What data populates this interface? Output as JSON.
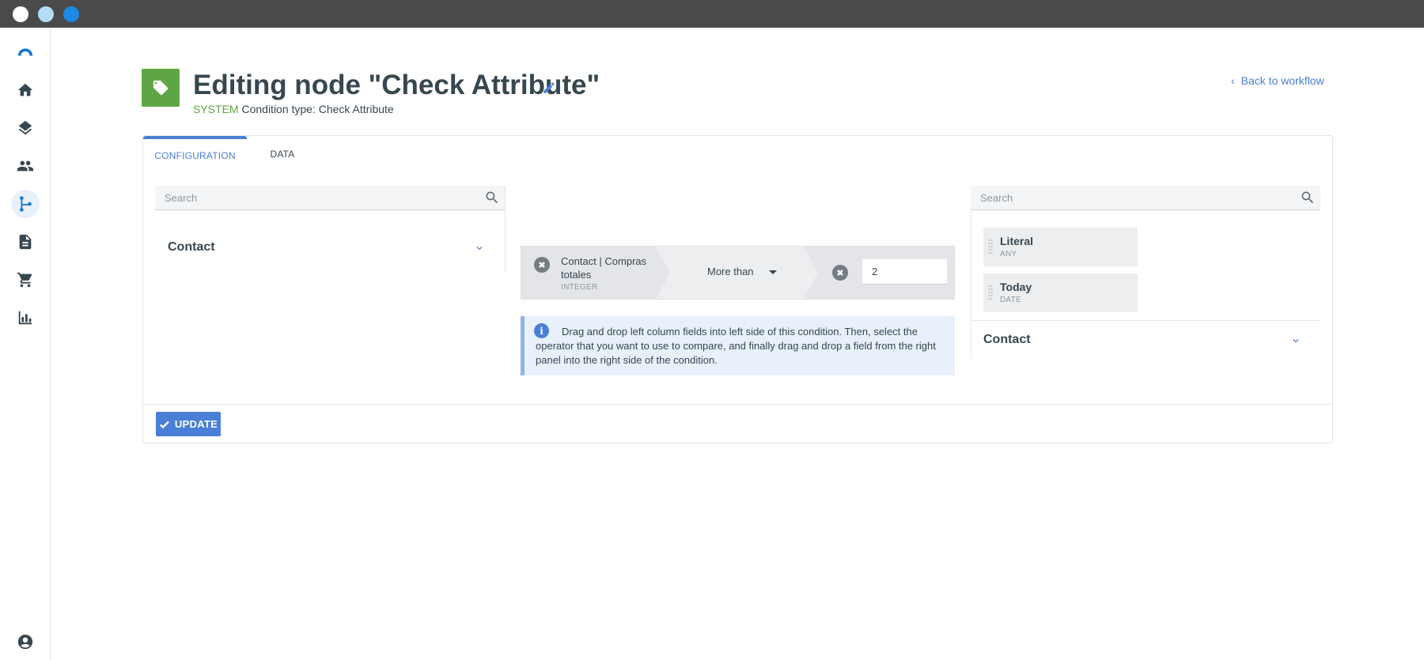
{
  "window": {
    "traffic_lights": [
      "close",
      "minimize",
      "maximize"
    ]
  },
  "sidebar": {
    "items": [
      {
        "icon": "logo-icon"
      },
      {
        "icon": "home-icon"
      },
      {
        "icon": "layers-icon"
      },
      {
        "icon": "people-icon"
      },
      {
        "icon": "workflow-icon",
        "active": true
      },
      {
        "icon": "document-icon"
      },
      {
        "icon": "cart-icon"
      },
      {
        "icon": "bar-chart-icon"
      },
      {
        "icon": "account-icon"
      }
    ]
  },
  "header": {
    "title": "Editing node \"Check Attribute\"",
    "system_label": "SYSTEM",
    "condition_type": "Condition type: Check Attribute",
    "back_link": "Back to workflow"
  },
  "tabs": [
    {
      "label": "CONFIGURATION",
      "active": true
    },
    {
      "label": "DATA",
      "active": false
    }
  ],
  "left_panel": {
    "search_placeholder": "Search",
    "group_label": "Contact"
  },
  "condition": {
    "left_field": "Contact | Compras totales",
    "left_type": "INTEGER",
    "operator": "More than",
    "value": "2"
  },
  "info": {
    "text": "Drag and drop left column fields into left side of this condition. Then, select the operator that you want to use to compare, and finally drag and drop a field from the right panel into the right side of the condition."
  },
  "right_panel": {
    "search_placeholder": "Search",
    "fields": [
      {
        "name": "Literal",
        "type": "ANY"
      },
      {
        "name": "Today",
        "type": "DATE"
      }
    ],
    "group_label": "Contact"
  },
  "footer": {
    "update_label": "UPDATE"
  },
  "colors": {
    "accent": "#4a7fd8",
    "node_tag": "#5ea545",
    "system_label": "#5ea545",
    "titlebar": "#4a4a4a"
  }
}
